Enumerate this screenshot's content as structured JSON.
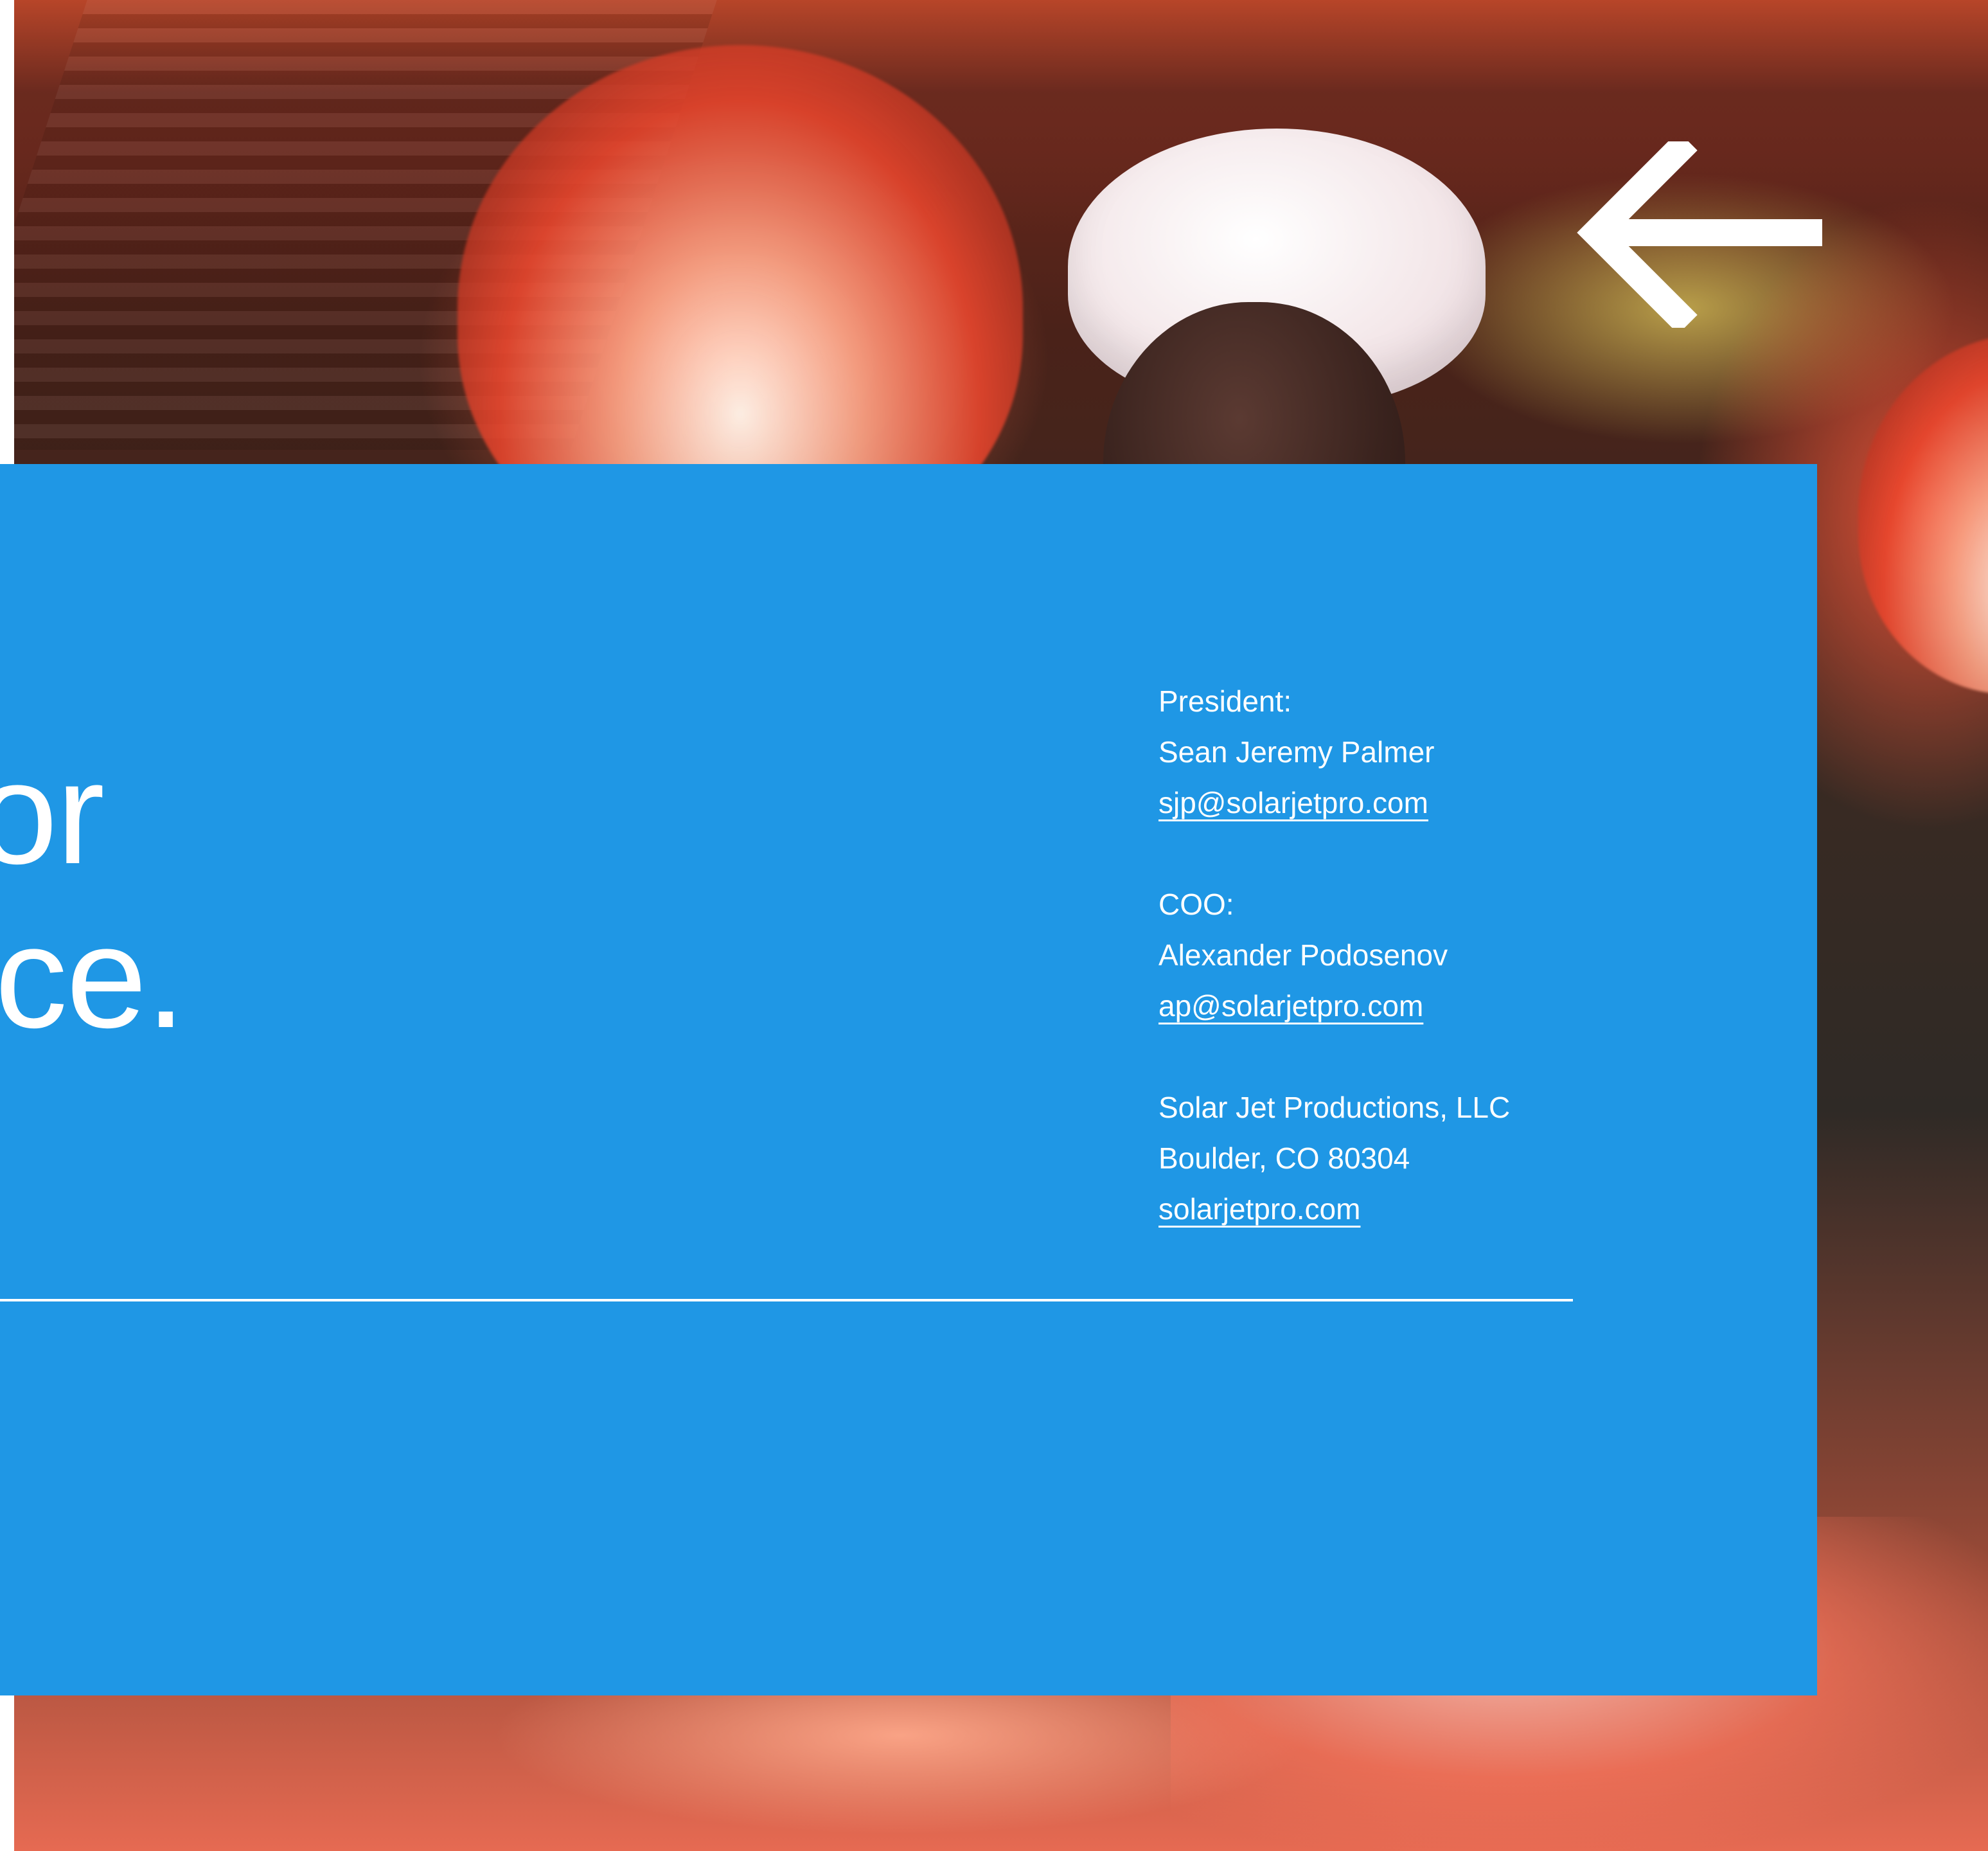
{
  "headline": {
    "line_1": "or",
    "line_2": "ce."
  },
  "icons": {
    "back": "back-arrow-icon"
  },
  "contacts": [
    {
      "role": "President:",
      "name": "Sean Jeremy Palmer",
      "email": "sjp@solarjetpro.com"
    },
    {
      "role": "COO:",
      "name": "Alexander Podosenov",
      "email": "ap@solarjetpro.com"
    }
  ],
  "company": {
    "name": "Solar Jet Productions, LLC",
    "location": "Boulder, CO 80304",
    "website": "solarjetpro.com"
  },
  "colors": {
    "panel": "#1f97e5",
    "text": "#ffffff"
  }
}
